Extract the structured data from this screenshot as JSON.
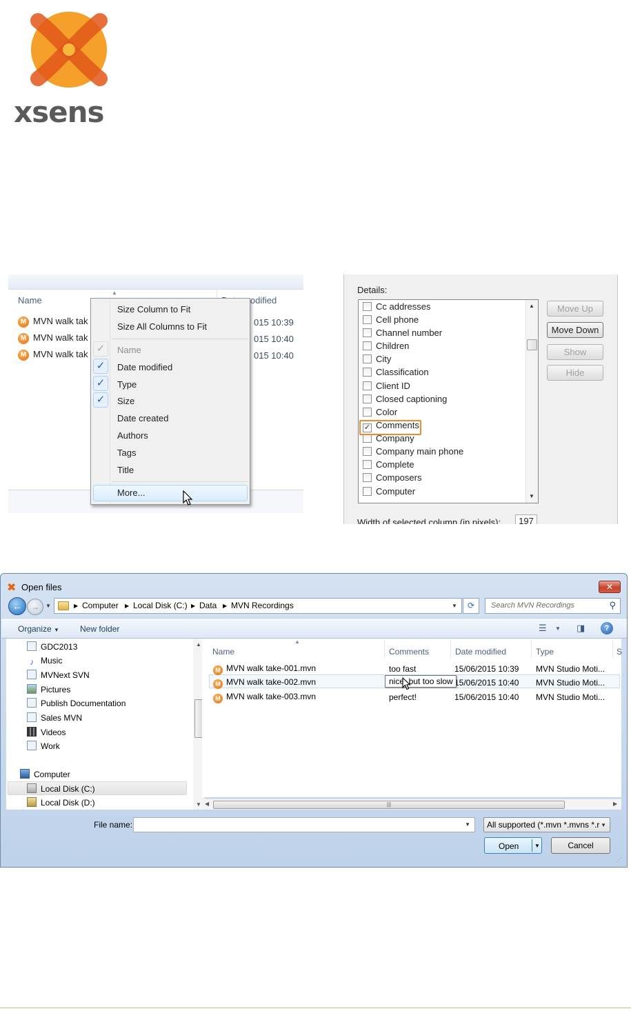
{
  "logo": {
    "text": "xsens",
    "colors": {
      "orange": "#f28c1e",
      "red": "#e0571a",
      "yellow": "#f7b93a",
      "grey": "#5a5a5a"
    }
  },
  "explorer_menu": {
    "column_headers": {
      "name": "Name",
      "date_modified": "Date modified"
    },
    "rows": [
      {
        "name": "MVN walk tak",
        "date": "015 10:39"
      },
      {
        "name": "MVN walk tak",
        "date": "015 10:40"
      },
      {
        "name": "MVN walk tak",
        "date": "015 10:40"
      }
    ],
    "menu_items": {
      "size_column": "Size Column to Fit",
      "size_all": "Size All Columns to Fit",
      "name": "Name",
      "date_modified": "Date modified",
      "type": "Type",
      "size": "Size",
      "date_created": "Date created",
      "authors": "Authors",
      "tags": "Tags",
      "title": "Title",
      "more": "More..."
    },
    "check_glyph": "✓"
  },
  "choose_details": {
    "label": "Details:",
    "items": [
      {
        "label": "Cc addresses",
        "checked": false
      },
      {
        "label": "Cell phone",
        "checked": false
      },
      {
        "label": "Channel number",
        "checked": false
      },
      {
        "label": "Children",
        "checked": false
      },
      {
        "label": "City",
        "checked": false
      },
      {
        "label": "Classification",
        "checked": false
      },
      {
        "label": "Client ID",
        "checked": false
      },
      {
        "label": "Closed captioning",
        "checked": false
      },
      {
        "label": "Color",
        "checked": false
      },
      {
        "label": "Comments",
        "checked": true
      },
      {
        "label": "Company",
        "checked": false
      },
      {
        "label": "Company main phone",
        "checked": false
      },
      {
        "label": "Complete",
        "checked": false
      },
      {
        "label": "Composers",
        "checked": false
      },
      {
        "label": "Computer",
        "checked": false
      }
    ],
    "buttons": {
      "move_up": "Move Up",
      "move_down": "Move Down",
      "show": "Show",
      "hide": "Hide"
    },
    "width_label": "Width of selected column (in pixels):",
    "width_value": "197",
    "highlight_color": "#ed8a2c"
  },
  "open_dialog": {
    "title": "Open files",
    "close": "✕",
    "breadcrumb": [
      "Computer",
      "Local Disk (C:)",
      "Data",
      "MVN Recordings"
    ],
    "search_placeholder": "Search MVN Recordings",
    "toolbar": {
      "organize": "Organize",
      "new_folder": "New folder",
      "help": "?"
    },
    "nav_items": [
      {
        "label": "GDC2013",
        "icon": "library-icon"
      },
      {
        "label": "Music",
        "icon": "music-icon"
      },
      {
        "label": "MVNext SVN",
        "icon": "library-icon"
      },
      {
        "label": "Pictures",
        "icon": "pictures-icon"
      },
      {
        "label": "Publish Documentation",
        "icon": "library-icon"
      },
      {
        "label": "Sales MVN",
        "icon": "library-icon"
      },
      {
        "label": "Videos",
        "icon": "videos-icon"
      },
      {
        "label": "Work",
        "icon": "library-icon"
      },
      {
        "label": "Computer",
        "icon": "computer-icon"
      },
      {
        "label": "Local Disk (C:)",
        "icon": "disk-icon"
      },
      {
        "label": "Local Disk (D:)",
        "icon": "disk-icon"
      }
    ],
    "columns": {
      "name": "Name",
      "comments": "Comments",
      "date_modified": "Date modified",
      "type": "Type",
      "size": "S"
    },
    "files": [
      {
        "name": "MVN walk take-001.mvn",
        "comment": "too fast",
        "date": "15/06/2015 10:39",
        "type": "MVN Studio Moti..."
      },
      {
        "name": "MVN walk take-002.mvn",
        "comment": "",
        "date": "15/06/2015 10:40",
        "type": "MVN Studio Moti..."
      },
      {
        "name": "MVN walk take-003.mvn",
        "comment": "perfect!",
        "date": "15/06/2015 10:40",
        "type": "MVN Studio Moti..."
      }
    ],
    "tooltip": "nice, but too slow",
    "file_name_label": "File name:",
    "file_name_value": "",
    "file_type": "All supported (*.mvn *.mvns *.r",
    "open_label": "Open",
    "cancel_label": "Cancel"
  }
}
